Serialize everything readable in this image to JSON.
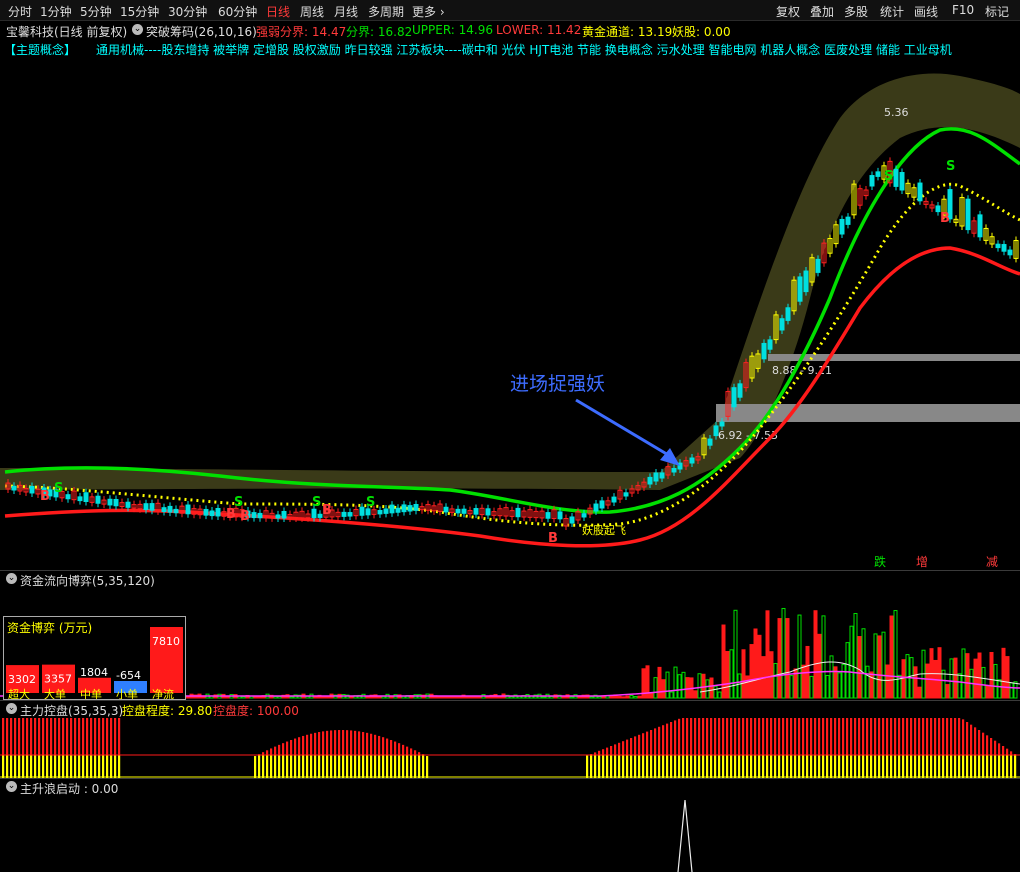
{
  "toolbar": {
    "left_items": [
      "分时",
      "1分钟",
      "5分钟",
      "15分钟",
      "30分钟",
      "60分钟",
      "日线",
      "周线",
      "月线",
      "多周期",
      "更多"
    ],
    "active": "日线",
    "right_items": [
      "复权",
      "叠加",
      "多股",
      "统计",
      "画线",
      "F10",
      "标记"
    ]
  },
  "info": {
    "stock": "宝馨科技(日线 前复权)",
    "indicator": "突破筹码(26,10,16)",
    "weak_label": "强弱分界: 14.47",
    "split_label": "分界: 16.82",
    "upper_label": "UPPER: 14.96",
    "lower_label": "LOWER: 11.42",
    "gold_label": "黄金通道: 13.19",
    "yao_label": "妖股: 0.00"
  },
  "concepts": {
    "label": "【主题概念】",
    "text": "通用机械----股东增持 被举牌 定增股 股权激励 昨日较强 江苏板块----碳中和 光伏 HJT电池 节能 换电概念 污水处理 智能电网 机器人概念 医废处理 储能 工业母机"
  },
  "main_chart": {
    "annotation": "进场捉强妖",
    "label_yao_start": "妖股起飞",
    "levels": [
      "8.88 - 9.11",
      "6.92 - 7.53"
    ],
    "top_value": "5.36",
    "markers": {
      "b": "B",
      "s": "S"
    },
    "bottom_tags": [
      "跌",
      "增",
      "减"
    ],
    "colors": {
      "green": "#00e000",
      "red": "#ff1a1a",
      "yellow": "#ffff00",
      "band": "#3a3a18"
    }
  },
  "fund_panel": {
    "title": "资金流向博弈(5,35,120)",
    "box_title": "资金博弈 (万元)",
    "bars": [
      {
        "label": "超大",
        "value": "3302",
        "color": "#ff1a1a",
        "num": 3302
      },
      {
        "label": "大单",
        "value": "3357",
        "color": "#ff1a1a",
        "num": 3357
      },
      {
        "label": "中单",
        "value": "1804",
        "color": "#ff1a1a",
        "num": 1804
      },
      {
        "label": "小单",
        "value": "-654",
        "color": "#2f7fff",
        "num": -654
      },
      {
        "label": "净流",
        "value": "7810",
        "color": "#ff1a1a",
        "num": 7810
      }
    ]
  },
  "control_panel": {
    "title": "主力控盘(35,35,3)",
    "degree_label": "控盘程度: 29.80",
    "ctrl_label": "控盘度: 100.00"
  },
  "wave_panel": {
    "title": "主升浪启动 : 0.00"
  }
}
